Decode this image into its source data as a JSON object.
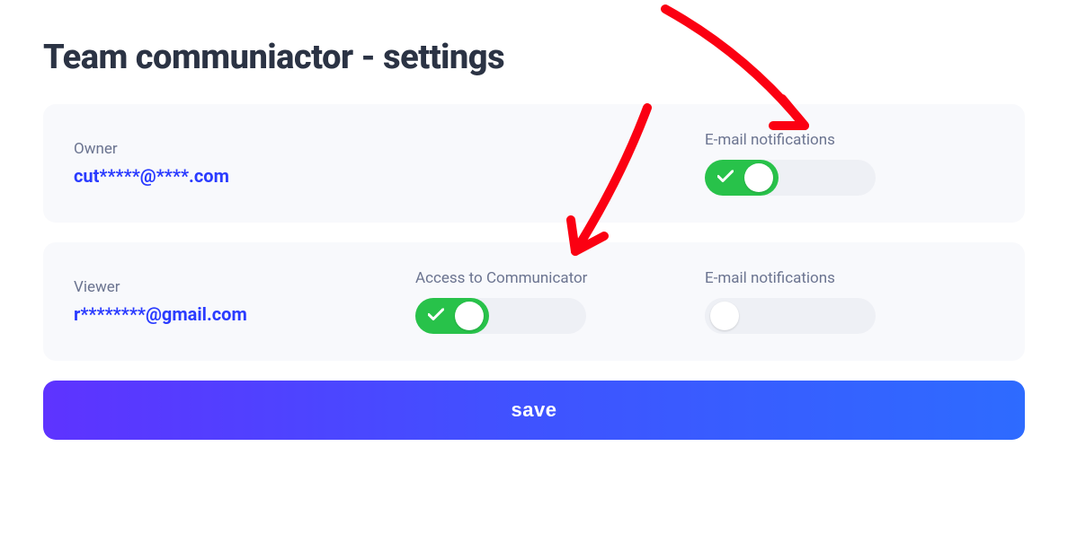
{
  "title": "Team communiactor - settings",
  "members": [
    {
      "role": "Owner",
      "email": "cut*****@****.com",
      "access_label": null,
      "access_on": null,
      "email_label": "E-mail notifications",
      "email_on": true
    },
    {
      "role": "Viewer",
      "email": "r********@gmail.com",
      "access_label": "Access to Communicator",
      "access_on": true,
      "email_label": "E-mail notifications",
      "email_on": false
    }
  ],
  "save_label": "save"
}
